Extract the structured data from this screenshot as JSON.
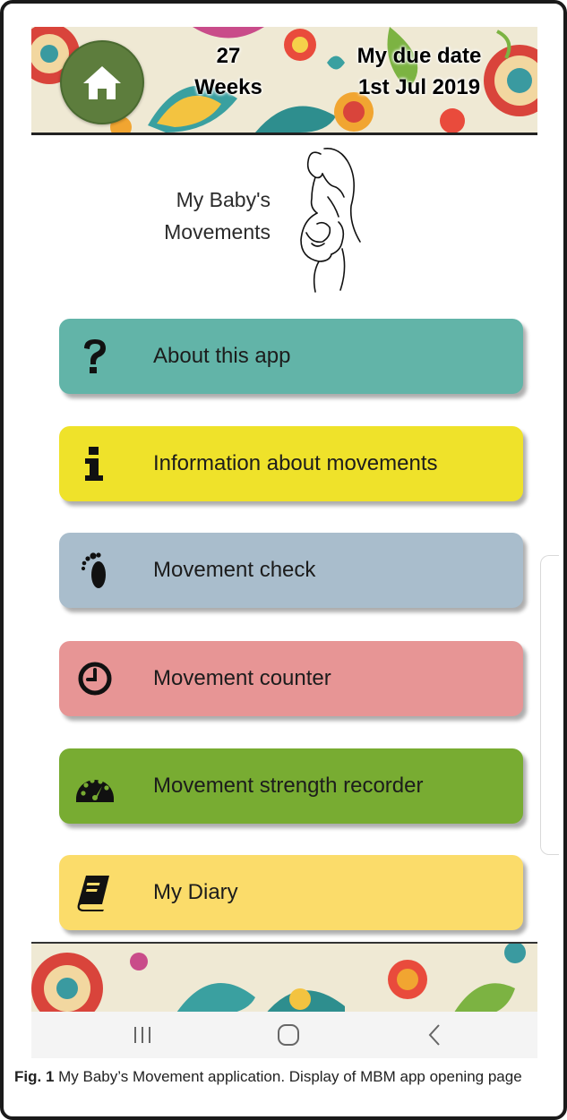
{
  "header": {
    "weeks_number": "27",
    "weeks_label": "Weeks",
    "due_label": "My due date",
    "due_date": "1st Jul 2019",
    "home_icon": "home-icon"
  },
  "title": {
    "line1": "My Baby's",
    "line2": "Movements"
  },
  "menu": [
    {
      "label": "About this app",
      "icon": "question-icon",
      "color": "#62b4a8"
    },
    {
      "label": "Information about movements",
      "icon": "info-icon",
      "color": "#efe22a"
    },
    {
      "label": "Movement check",
      "icon": "footprint-icon",
      "color": "#a9bdcc"
    },
    {
      "label": "Movement counter",
      "icon": "clock-icon",
      "color": "#e79595"
    },
    {
      "label": "Movement strength recorder",
      "icon": "gauge-icon",
      "color": "#78ac32"
    },
    {
      "label": "My Diary",
      "icon": "book-icon",
      "color": "#fbdc6a"
    }
  ],
  "navbar": {
    "recents_icon": "recents-icon",
    "home_icon": "home-circle-icon",
    "back_icon": "back-chevron-icon"
  },
  "caption": {
    "fig": "Fig. 1",
    "text": " My Baby’s Movement application. Display of MBM app opening page"
  },
  "colors": {
    "home_button": "#5d7d3d",
    "banner_bg": "#efe9d4"
  }
}
